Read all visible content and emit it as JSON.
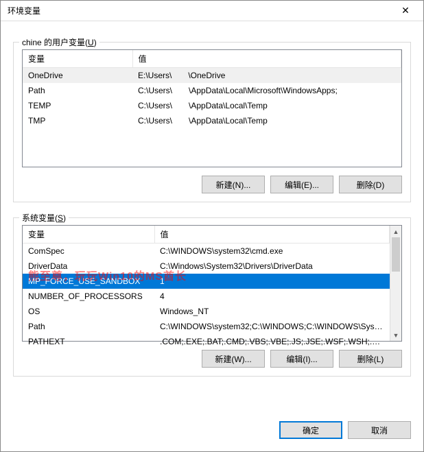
{
  "title": "环境变量",
  "close_x": "✕",
  "user_section": {
    "label_prefix": "chine 的用户变量(",
    "label_hotkey": "U",
    "label_suffix": ")",
    "headers": {
      "name": "变量",
      "value": "值"
    },
    "rows": [
      {
        "name": "OneDrive",
        "val1": "E:\\Users\\",
        "val2": "\\OneDrive",
        "selected": true
      },
      {
        "name": "Path",
        "val1": "C:\\Users\\",
        "val2": "\\AppData\\Local\\Microsoft\\WindowsApps;"
      },
      {
        "name": "TEMP",
        "val1": "C:\\Users\\",
        "val2": "\\AppData\\Local\\Temp"
      },
      {
        "name": "TMP",
        "val1": "C:\\Users\\",
        "val2": "\\AppData\\Local\\Temp"
      }
    ],
    "buttons": {
      "new": "新建(N)...",
      "edit": "编辑(E)...",
      "del": "删除(D)"
    }
  },
  "sys_section": {
    "label_prefix": "系统变量(",
    "label_hotkey": "S",
    "label_suffix": ")",
    "headers": {
      "name": "变量",
      "value": "值"
    },
    "rows": [
      {
        "name": "ComSpec",
        "value": "C:\\WINDOWS\\system32\\cmd.exe"
      },
      {
        "name": "DriverData",
        "value": "C:\\Windows\\System32\\Drivers\\DriverData"
      },
      {
        "name": "MP_FORCE_USE_SANDBOX",
        "value": "1",
        "hl": true
      },
      {
        "name": "NUMBER_OF_PROCESSORS",
        "value": "4"
      },
      {
        "name": "OS",
        "value": "Windows_NT"
      },
      {
        "name": "Path",
        "value": "C:\\WINDOWS\\system32;C:\\WINDOWS;C:\\WINDOWS\\System..."
      },
      {
        "name": "PATHEXT",
        "value": ".COM;.EXE;.BAT;.CMD;.VBS;.VBE;.JS;.JSE;.WSF;.WSH;.MSC"
      }
    ],
    "buttons": {
      "new": "新建(W)...",
      "edit": "编辑(I)...",
      "del": "删除(L)"
    }
  },
  "watermark": "熊至尊，玩玩Win10的MS酋长",
  "footer": {
    "ok": "确定",
    "cancel": "取消"
  }
}
